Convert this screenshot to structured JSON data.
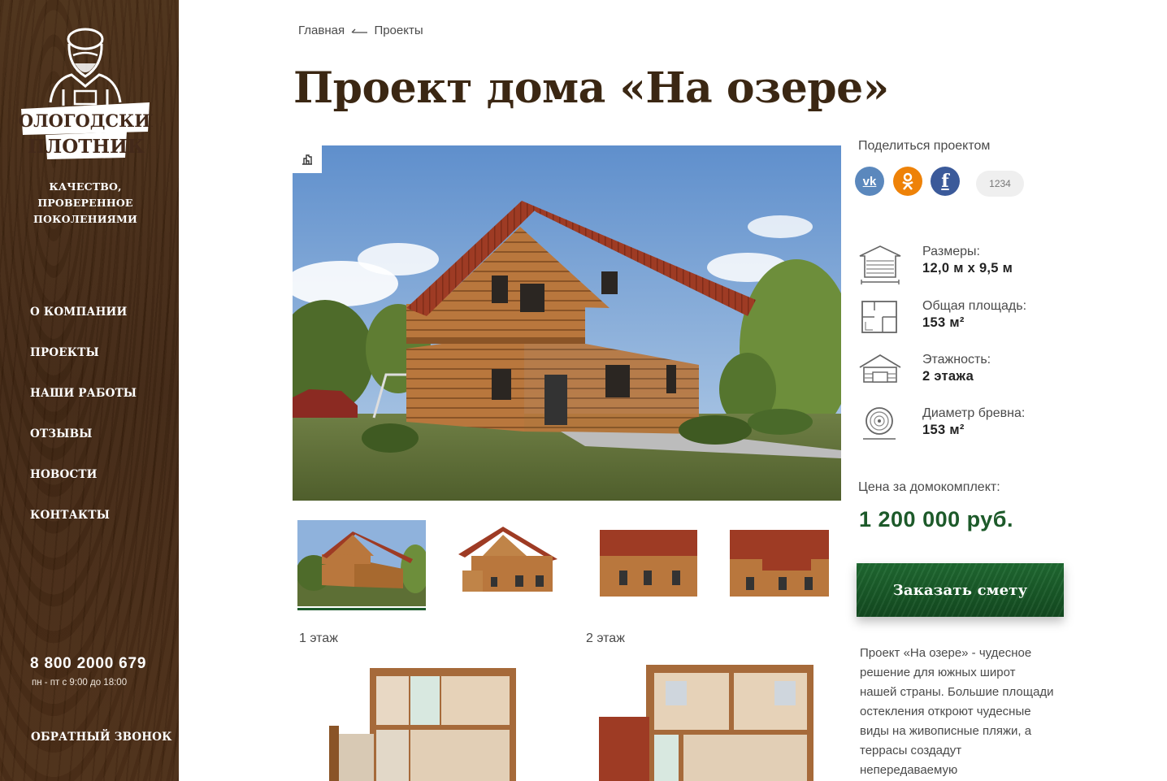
{
  "brand": {
    "logo_line1": "ВОЛОГОДСКИЙ",
    "logo_line2": "ПЛОТНИК",
    "tagline": [
      "КАЧЕСТВО,",
      "ПРОВЕРЕННОЕ",
      "ПОКОЛЕНИЯМИ"
    ]
  },
  "nav": {
    "items": [
      "О КОМПАНИИ",
      "ПРОЕКТЫ",
      "НАШИ РАБОТЫ",
      "ОТЗЫВЫ",
      "НОВОСТИ",
      "КОНТАКТЫ"
    ]
  },
  "contacts": {
    "phone": "8 800 2000 679",
    "hours": "пн - пт с 9:00 до 18:00",
    "callback": "ОБРАТНЫЙ ЗВОНОК"
  },
  "breadcrumb": {
    "home": "Главная",
    "current": "Проекты"
  },
  "page_title": "Проект дома «На озере»",
  "gallery": {
    "thumb_count": 4,
    "active_index": 0
  },
  "floors": {
    "first": "1 этаж",
    "second": "2 этаж"
  },
  "share": {
    "label": "Поделиться проектом",
    "count": "1234"
  },
  "specs": [
    {
      "icon": "dimensions-icon",
      "label": "Размеры:",
      "value": "12,0 м х 9,5 м"
    },
    {
      "icon": "floor-plan-icon",
      "label": "Общая площадь:",
      "value": "153 м²"
    },
    {
      "icon": "floors-icon",
      "label": "Этажность:",
      "value": "2 этажа"
    },
    {
      "icon": "log-diameter-icon",
      "label": "Диаметр бревна:",
      "value": "153 м²"
    }
  ],
  "price": {
    "label": "Цена за домокомплект:",
    "value": "1 200 000 руб."
  },
  "order_button": "Заказать смету",
  "description": "Проект «На озере» - чудесное решение для южных широт нашей страны. Большие площади остекления откроют чудесные виды на живописные пляжи, а террасы создадут непередаваемую",
  "colors": {
    "sidebar": "#43291a",
    "accent_green": "#1d5a2a",
    "title_brown": "#3b2713"
  }
}
